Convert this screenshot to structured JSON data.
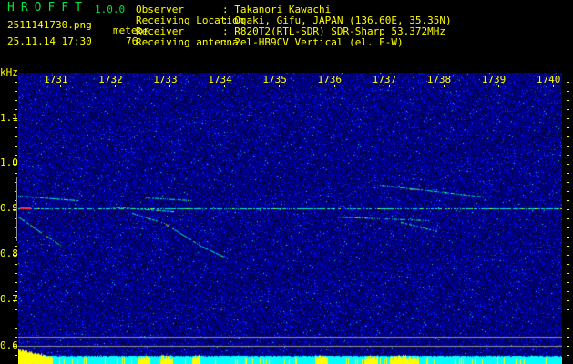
{
  "header": {
    "app_name": "HROFFT",
    "version": "1.0.0",
    "filename": "2511141730.png",
    "datetime": "25.11.14 17:30",
    "count_label": "meteor",
    "count_value": "76"
  },
  "info": [
    {
      "label": "Observer",
      "value": ": Takanori Kawachi"
    },
    {
      "label": "Receiving Location",
      "value": ": Ogaki, Gifu, JAPAN (136.60E, 35.35N)"
    },
    {
      "label": "Receiver",
      "value": ": R820T2(RTL-SDR) SDR-Sharp 53.372MHz"
    },
    {
      "label": "Receiving antenna",
      "value": ": 2el-HB9CV Vertical (el. E-W)"
    }
  ],
  "axis": {
    "y_unit": "kHz",
    "y_labels": [
      "1.1",
      "1.0",
      "0.9",
      "0.8",
      "0.7",
      "0.6"
    ],
    "x_labels": [
      "1731",
      "1732",
      "1733",
      "1734",
      "1735",
      "1736",
      "1737",
      "1738",
      "1739",
      "1740"
    ]
  },
  "colors": {
    "text": "#ffff00",
    "title": "#00e040",
    "background_noise": "#0a1a9a",
    "signal": "#00ffff"
  }
}
